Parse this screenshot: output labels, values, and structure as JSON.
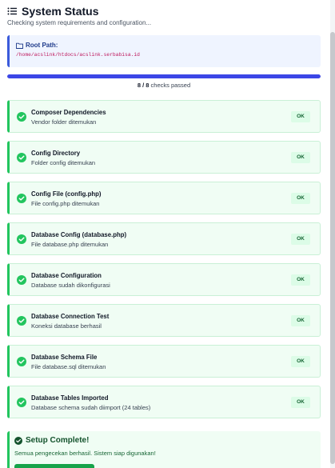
{
  "header": {
    "title": "System Status",
    "subtitle": "Checking system requirements and configuration..."
  },
  "root": {
    "label": "Root Path:",
    "path": "/home/acslink/htdocs/acslink.serbabisa.id"
  },
  "progress": {
    "passed": "8 / 8",
    "suffix": " checks passed",
    "fraction": 1.0
  },
  "checks": [
    {
      "name": "Composer Dependencies",
      "desc": "Vendor folder ditemukan",
      "status": "OK"
    },
    {
      "name": "Config Directory",
      "desc": "Folder config ditemukan",
      "status": "OK"
    },
    {
      "name": "Config File (config.php)",
      "desc": "File config.php ditemukan",
      "status": "OK"
    },
    {
      "name": "Database Config (database.php)",
      "desc": "File database.php ditemukan",
      "status": "OK"
    },
    {
      "name": "Database Configuration",
      "desc": "Database sudah dikonfigurasi",
      "status": "OK"
    },
    {
      "name": "Database Connection Test",
      "desc": "Koneksi database berhasil",
      "status": "OK"
    },
    {
      "name": "Database Schema File",
      "desc": "File database.sql ditemukan",
      "status": "OK"
    },
    {
      "name": "Database Tables Imported",
      "desc": "Database schema sudah diimport (24 tables)",
      "status": "OK"
    }
  ],
  "complete": {
    "title": "Setup Complete!",
    "message": "Semua pengecekan berhasil. Sistem siap digunakan!"
  },
  "colors": {
    "accent": "#3b46e6",
    "success": "#22c55e",
    "success_bg": "#f0fdf4"
  },
  "icons": {
    "title": "list-icon",
    "root": "folder-icon",
    "check": "check-circle-icon",
    "complete": "check-circle-icon"
  }
}
